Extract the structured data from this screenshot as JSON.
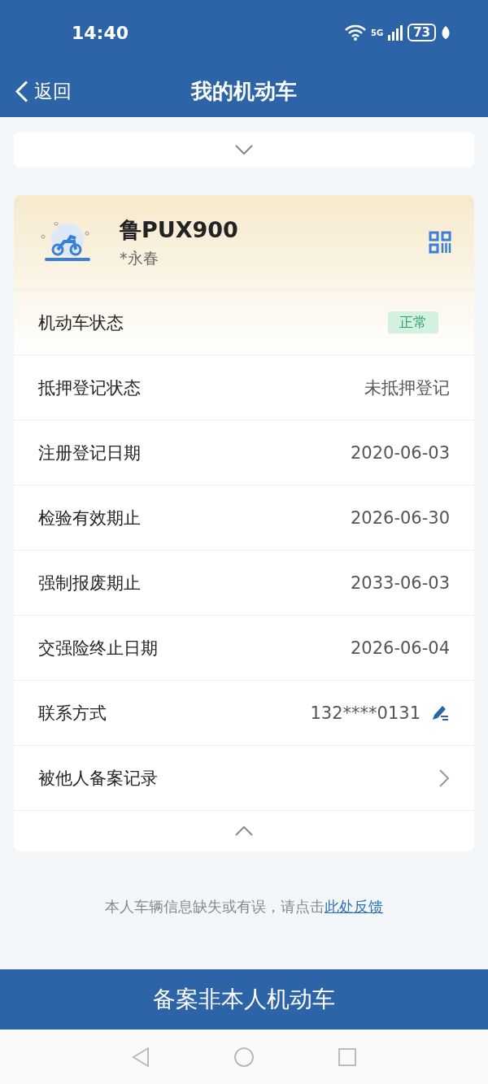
{
  "status_bar": {
    "time": "14:40",
    "network": "5G",
    "battery": "73"
  },
  "nav": {
    "back": "返回",
    "title": "我的机动车"
  },
  "vehicle": {
    "plate": "鲁PUX900",
    "owner": "*永春"
  },
  "rows": [
    {
      "kind": "badge",
      "label": "机动车状态",
      "value": "正常"
    },
    {
      "kind": "text",
      "label": "抵押登记状态",
      "value": "未抵押登记"
    },
    {
      "kind": "text",
      "label": "注册登记日期",
      "value": "2020-06-03"
    },
    {
      "kind": "text",
      "label": "检验有效期止",
      "value": "2026-06-30"
    },
    {
      "kind": "text",
      "label": "强制报废期止",
      "value": "2033-06-03"
    },
    {
      "kind": "text",
      "label": "交强险终止日期",
      "value": "2026-06-04"
    },
    {
      "kind": "editable",
      "label": "联系方式",
      "value": "132****0131"
    },
    {
      "kind": "link",
      "label": "被他人备案记录"
    }
  ],
  "feedback": {
    "text": "本人车辆信息缺失或有误，请点击",
    "link": "此处反馈"
  },
  "primary_button": "备案非本人机动车"
}
